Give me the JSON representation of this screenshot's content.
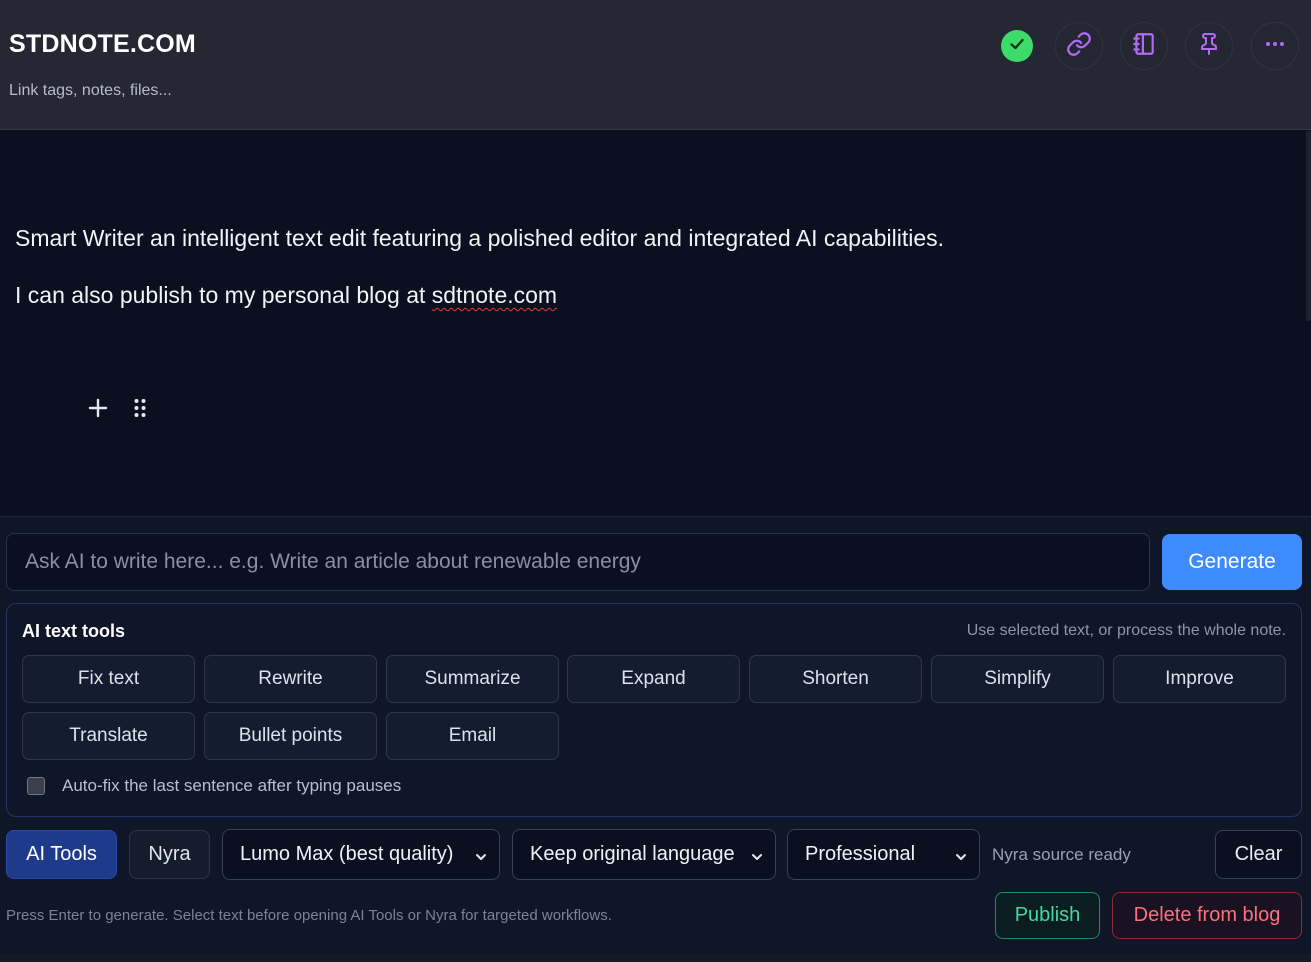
{
  "header": {
    "title": "STDNOTE.COM",
    "tags_placeholder": "Link tags, notes, files...",
    "icons": {
      "status": "check-circle-icon",
      "link": "link-icon",
      "notebook": "notebook-icon",
      "pin": "pin-icon",
      "more": "more-horizontal-icon"
    },
    "colors": {
      "accent_icon": "#b06cf5",
      "status_ok": "#3ddc6a"
    }
  },
  "editor": {
    "paragraphs": [
      "Smart Writer an intelligent text edit featuring a polished editor and integrated AI capabilities.",
      "I can also publish to my personal blog at "
    ],
    "link_text": "sdtnote.com"
  },
  "ai": {
    "prompt_placeholder": "Ask AI to write here... e.g. Write an article about renewable energy",
    "prompt_value": "",
    "generate_label": "Generate",
    "tools_title": "AI text tools",
    "tools_hint": "Use selected text, or process the whole note.",
    "tools": [
      "Fix text",
      "Rewrite",
      "Summarize",
      "Expand",
      "Shorten",
      "Simplify",
      "Improve",
      "Translate",
      "Bullet points",
      "Email"
    ],
    "autofix_label": "Auto-fix the last sentence after typing pauses",
    "autofix_checked": false
  },
  "controls": {
    "ai_tools_label": "AI Tools",
    "nyra_label": "Nyra",
    "model_select": "Lumo Max (best quality)",
    "language_select": "Keep original language",
    "tone_select": "Professional",
    "nyra_status": "Nyra source ready",
    "clear_label": "Clear"
  },
  "footer": {
    "hint": "Press Enter to generate. Select text before opening AI Tools or Nyra for targeted workflows.",
    "publish_label": "Publish",
    "delete_label": "Delete from blog"
  }
}
